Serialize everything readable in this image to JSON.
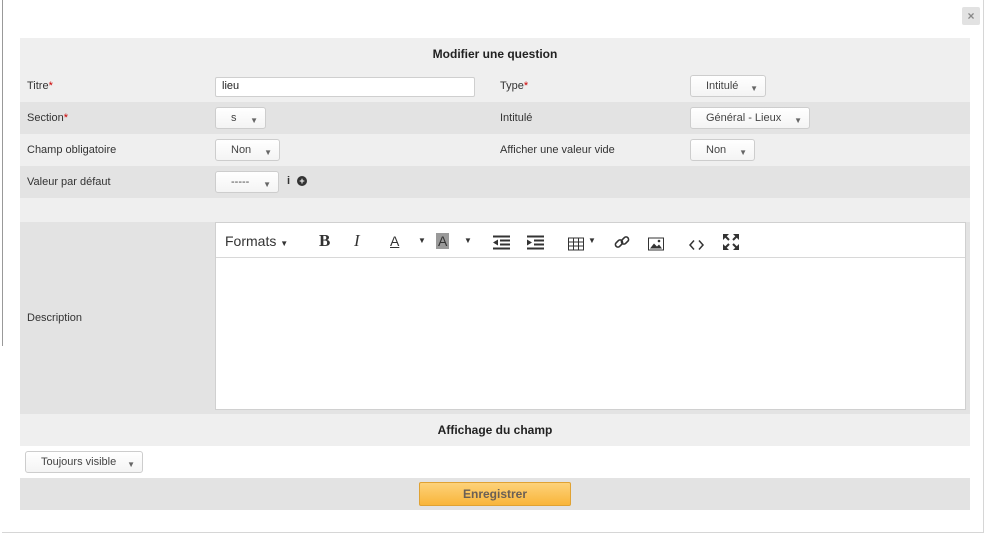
{
  "dialog": {
    "close_label": "×",
    "title": "Modifier une question",
    "section_display_title": "Affichage du champ",
    "submit_label": "Enregistrer"
  },
  "fields": {
    "titre": {
      "label": "Titre",
      "required_mark": "*",
      "value": "lieu"
    },
    "type": {
      "label": "Type",
      "required_mark": "*",
      "value": "Intitulé"
    },
    "section": {
      "label": "Section",
      "required_mark": "*",
      "value": "s"
    },
    "intitule": {
      "label": "Intitulé",
      "value": "Général - Lieux"
    },
    "champ_obligatoire": {
      "label": "Champ obligatoire",
      "value": "Non"
    },
    "valeur_vide": {
      "label": "Afficher une valeur vide",
      "value": "Non"
    },
    "valeur_defaut": {
      "label": "Valeur par défaut",
      "value": "-----",
      "info_icon": "i",
      "add_icon": "+"
    },
    "description": {
      "label": "Description",
      "value": ""
    },
    "affichage": {
      "value": "Toujours visible"
    }
  },
  "editor_toolbar": {
    "formats_label": "Formats",
    "bold": "B",
    "italic": "I",
    "text_color": "A",
    "bg_color": "A",
    "caret": "▼",
    "icons": [
      "outdent-icon",
      "indent-icon",
      "table-icon",
      "link-icon",
      "image-icon",
      "code-icon",
      "fullscreen-icon"
    ]
  },
  "select_arrow": "▼"
}
